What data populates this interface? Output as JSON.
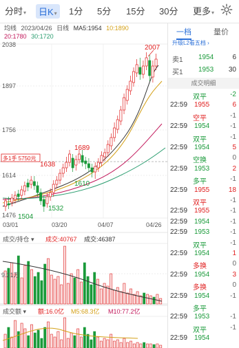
{
  "tabs": [
    {
      "label": "分时",
      "caret": "▾"
    },
    {
      "label": "日K",
      "caret": "▾"
    },
    {
      "label": "1分",
      "caret": ""
    },
    {
      "label": "5分",
      "caret": ""
    },
    {
      "label": "15分",
      "caret": ""
    },
    {
      "label": "30分",
      "caret": ""
    },
    {
      "label": "更多",
      "caret": "▾"
    }
  ],
  "legend": {
    "mode": "均线",
    "date": "2023/04/26",
    "period": "日线",
    "ma5": "MA5:1954",
    "ma10": "10:1890",
    "ma20": "20:1780",
    "ma30": "30:1720"
  },
  "price_axis": {
    "top": "2038",
    "p1": "1897",
    "p2": "1756",
    "p3": "1614",
    "bottom": "1476"
  },
  "annotations": {
    "high": "2007",
    "p1689": "1689",
    "p1638": "1638",
    "p1610": "1610",
    "p1532": "1532",
    "p1504": "1504",
    "tag": "多1手 5750元"
  },
  "dates": [
    "03/01",
    "03/20",
    "04/07",
    "04/26"
  ],
  "volume": {
    "title": "成交/持仓",
    "value": "成交:40767",
    "vol5": "成交:46387",
    "axis_label": "9.21万"
  },
  "amount": {
    "title": "成交额",
    "value": "额:16.0亿",
    "m5": "M5:68.3亿",
    "m10": "M10:77.2亿"
  },
  "book": {
    "tab_active": "一档",
    "tab_other": "量价",
    "upgrade": "升级L2看五档 ›",
    "sell_label": "卖1",
    "sell_price": "1954",
    "sell_vol": "6",
    "buy_label": "买1",
    "buy_price": "1953",
    "buy_vol": "30",
    "detail_title": "成交明细"
  },
  "trades": [
    {
      "time": "",
      "type": "双平",
      "type_color": "green",
      "price": "",
      "vol": "-2",
      "vol_color": "green"
    },
    {
      "time": "22:59",
      "type": "",
      "price": "1955",
      "price_color": "red",
      "vol": "6",
      "vol_color": "red"
    },
    {
      "time": "",
      "type": "空平",
      "type_color": "red",
      "price": "",
      "vol": "-1",
      "vol_color": "gray"
    },
    {
      "time": "22:59",
      "type": "",
      "price": "1954",
      "price_color": "green",
      "vol": "-1",
      "vol_color": "gray"
    },
    {
      "time": "",
      "type": "双平",
      "type_color": "green",
      "price": "",
      "vol": "-1",
      "vol_color": "gray"
    },
    {
      "time": "22:59",
      "type": "",
      "price": "1954",
      "price_color": "green",
      "vol": "5",
      "vol_color": "red"
    },
    {
      "time": "",
      "type": "空换",
      "type_color": "green",
      "price": "",
      "vol": "0",
      "vol_color": "gray"
    },
    {
      "time": "22:59",
      "type": "",
      "price": "1953",
      "price_color": "green",
      "vol": "2",
      "vol_color": "red"
    },
    {
      "time": "",
      "type": "多平",
      "type_color": "green",
      "price": "",
      "vol": "-1",
      "vol_color": "gray"
    },
    {
      "time": "22:59",
      "type": "",
      "price": "1955",
      "price_color": "red",
      "vol": "18",
      "vol_color": "red"
    },
    {
      "time": "",
      "type": "双平",
      "type_color": "red",
      "price": "",
      "vol": "-1",
      "vol_color": "gray"
    },
    {
      "time": "22:59",
      "type": "",
      "price": "1955",
      "price_color": "red",
      "vol": "-1",
      "vol_color": "gray"
    },
    {
      "time": "22:59",
      "type": "",
      "price": "1954",
      "price_color": "green",
      "vol": "-1",
      "vol_color": "gray"
    },
    {
      "time": "22:59",
      "type": "",
      "price": "1953",
      "price_color": "green",
      "vol": "-1",
      "vol_color": "gray"
    },
    {
      "time": "",
      "type": "双平",
      "type_color": "green",
      "price": "",
      "vol": "-1",
      "vol_color": "gray"
    },
    {
      "time": "22:59",
      "type": "",
      "price": "1954",
      "price_color": "green",
      "vol": "1",
      "vol_color": "red"
    },
    {
      "time": "",
      "type": "多换",
      "type_color": "red",
      "price": "",
      "vol": "0",
      "vol_color": "gray"
    },
    {
      "time": "22:59",
      "type": "",
      "price": "1954",
      "price_color": "green",
      "vol": "3",
      "vol_color": "red"
    },
    {
      "time": "",
      "type": "多换",
      "type_color": "red",
      "price": "",
      "vol": "0",
      "vol_color": "gray"
    },
    {
      "time": "22:59",
      "type": "",
      "price": "1954",
      "price_color": "green",
      "vol": "-1",
      "vol_color": "gray"
    },
    {
      "time": "",
      "type": "多平",
      "type_color": "green",
      "price": "",
      "vol": "",
      "vol_color": "gray"
    },
    {
      "time": "22:59",
      "type": "",
      "price": "1953",
      "price_color": "green",
      "vol": "-1",
      "vol_color": "gray"
    },
    {
      "time": "",
      "type": "双平",
      "type_color": "green",
      "price": "",
      "vol": "-1",
      "vol_color": "gray"
    },
    {
      "time": "22:59",
      "type": "",
      "price": "1954",
      "price_color": "green",
      "vol": "",
      "vol_color": "gray"
    }
  ],
  "colors": {
    "accent": "#2a6fd8",
    "up": "#e02020",
    "down": "#1a9a3a"
  }
}
